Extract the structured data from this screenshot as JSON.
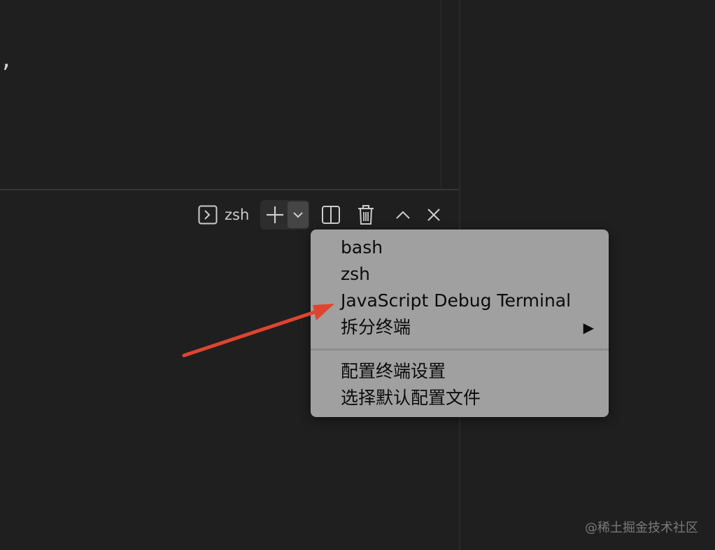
{
  "editor": {
    "visible_text": ","
  },
  "terminal_toolbar": {
    "icon": "terminal-icon",
    "active_terminal": "zsh",
    "buttons": [
      {
        "name": "new-terminal",
        "icon": "plus-icon"
      },
      {
        "name": "launch-profile-dropdown",
        "icon": "chevron-down-icon"
      },
      {
        "name": "split-terminal",
        "icon": "split-icon"
      },
      {
        "name": "kill-terminal",
        "icon": "trash-icon"
      },
      {
        "name": "maximize-panel",
        "icon": "chevron-up-icon"
      },
      {
        "name": "close-panel",
        "icon": "close-icon"
      }
    ]
  },
  "menu": {
    "items": [
      "bash",
      "zsh",
      "JavaScript Debug Terminal",
      "拆分终端"
    ],
    "submenu_arrow": "▶",
    "items2": [
      "配置终端设置",
      "选择默认配置文件"
    ]
  },
  "annotation": {
    "color": "#e0442f"
  },
  "watermark": "@稀土掘金技术社区"
}
